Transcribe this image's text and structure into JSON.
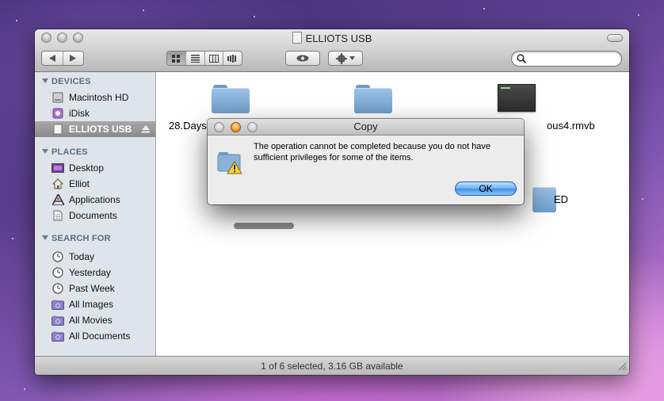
{
  "window": {
    "title": "ELLIOTS USB",
    "status": "1 of 6 selected, 3.16 GB available"
  },
  "sidebar": {
    "devices_header": "DEVICES",
    "devices": [
      {
        "label": "Macintosh HD",
        "icon": "hard-drive-icon"
      },
      {
        "label": "iDisk",
        "icon": "idisk-icon"
      },
      {
        "label": "ELLIOTS USB",
        "icon": "usb-drive-icon",
        "selected": true
      }
    ],
    "places_header": "PLACES",
    "places": [
      {
        "label": "Desktop",
        "icon": "desktop-icon"
      },
      {
        "label": "Elliot",
        "icon": "home-icon"
      },
      {
        "label": "Applications",
        "icon": "applications-icon"
      },
      {
        "label": "Documents",
        "icon": "documents-icon"
      }
    ],
    "search_header": "SEARCH FOR",
    "search_for": [
      {
        "label": "Today",
        "icon": "clock-icon"
      },
      {
        "label": "Yesterday",
        "icon": "clock-icon"
      },
      {
        "label": "Past Week",
        "icon": "clock-icon"
      },
      {
        "label": "All Images",
        "icon": "smart-folder-icon"
      },
      {
        "label": "All Movies",
        "icon": "smart-folder-icon"
      },
      {
        "label": "All Documents",
        "icon": "smart-folder-icon"
      }
    ]
  },
  "files": [
    {
      "name": "28.Days.",
      "icon": "folder-icon"
    },
    {
      "name": "",
      "icon": "folder-icon"
    },
    {
      "name": "ous4.rmvb",
      "icon": "video-file-icon"
    },
    {
      "name": "ED",
      "icon": "folder-icon"
    }
  ],
  "dialog": {
    "title": "Copy",
    "message": "The operation cannot be completed because you do not have sufficient privileges for some of the items.",
    "ok_label": "OK"
  },
  "colors": {
    "selection": "#8a8a8a",
    "ok_button": "#4f9be8",
    "sidebar": "#dee4ea"
  }
}
